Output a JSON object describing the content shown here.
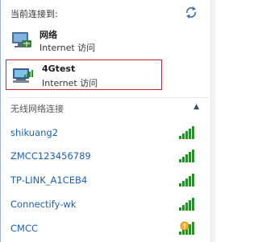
{
  "header": {
    "title": "当前连接到:",
    "refresh_icon": "refresh-icon"
  },
  "connections": [
    {
      "name": "网络",
      "status": "Internet 访问",
      "icon": "network-icon",
      "selected": false
    },
    {
      "name": "4Gtest",
      "status": "Internet 访问",
      "icon": "wifi-computer-icon",
      "selected": true
    }
  ],
  "wireless": {
    "header": "无线网络连接",
    "collapse_icon": "chevron-up-icon",
    "networks": [
      {
        "name": "shikuang2",
        "signal_bars": 5,
        "secured_warning": false
      },
      {
        "name": "ZMCC123456789",
        "signal_bars": 5,
        "secured_warning": false
      },
      {
        "name": "TP-LINK_A1CEB4",
        "signal_bars": 5,
        "secured_warning": false
      },
      {
        "name": "Connectify-wk",
        "signal_bars": 5,
        "secured_warning": false
      },
      {
        "name": "CMCC",
        "signal_bars": 5,
        "secured_warning": true
      }
    ]
  },
  "colors": {
    "link": "#1f5fa8",
    "signal": "#2e8b2e",
    "selection_border": "#c8252a"
  }
}
